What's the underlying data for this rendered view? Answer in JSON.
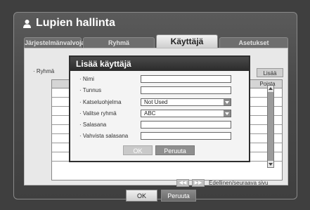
{
  "window": {
    "title": "Lupien hallinta"
  },
  "tabs": [
    {
      "label": "Järjestelmänvalvoja"
    },
    {
      "label": "Ryhmä"
    },
    {
      "label": "Käyttäjä"
    },
    {
      "label": "Asetukset"
    }
  ],
  "group_label": "· Ryhmä",
  "add_button": "Lisää",
  "table": {
    "headers": [
      "Ryhm",
      "Poista"
    ],
    "row_count": 8
  },
  "pager": {
    "prev_icon": "rewind-icon",
    "next_icon": "fast-forward-icon",
    "text": "Edellinen/seuraava sivu"
  },
  "footer": {
    "ok": "OK",
    "cancel": "Peruuta"
  },
  "dialog": {
    "title": "Lisää käyttäjä",
    "fields": {
      "name": {
        "label": "· Nimi",
        "value": ""
      },
      "id": {
        "label": "· Tunnus",
        "value": ""
      },
      "viewer": {
        "label": "· Katseluohjelma",
        "value": "Not Used"
      },
      "group": {
        "label": "· Valitse ryhmä",
        "value": "ABC"
      },
      "password": {
        "label": "· Salasana",
        "value": ""
      },
      "confirm": {
        "label": "· Vahvista salasana",
        "value": ""
      }
    },
    "ok": "OK",
    "cancel": "Peruuta"
  }
}
